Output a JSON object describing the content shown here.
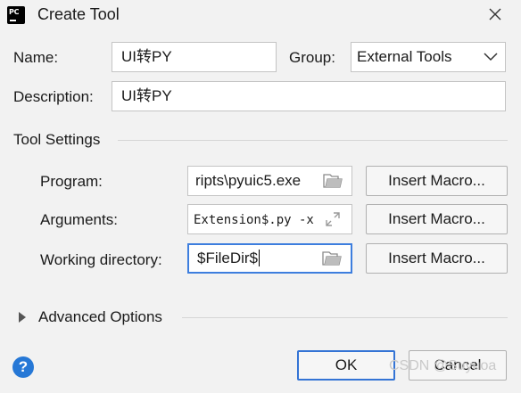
{
  "window": {
    "title": "Create Tool",
    "app_icon_text": "PC"
  },
  "form": {
    "name_label": "Name:",
    "name_value": "UI转PY",
    "group_label": "Group:",
    "group_value": "External Tools",
    "description_label": "Description:",
    "description_value": "UI转PY"
  },
  "tool_settings": {
    "section_title": "Tool Settings",
    "program_label": "Program:",
    "program_value": "ripts\\pyuic5.exe",
    "arguments_label": "Arguments:",
    "arguments_value": "Extension$.py -x",
    "working_dir_label": "Working directory:",
    "working_dir_value": "$FileDir$",
    "insert_macro_label": "Insert Macro..."
  },
  "advanced": {
    "label": "Advanced Options"
  },
  "footer": {
    "help_label": "?",
    "ok_label": "OK",
    "cancel_label": "Cancel"
  },
  "watermark": "CSDN @Suyuoa",
  "colors": {
    "accent": "#3d7ede",
    "help_icon": "#2678d6",
    "background": "#f2f2f2"
  }
}
